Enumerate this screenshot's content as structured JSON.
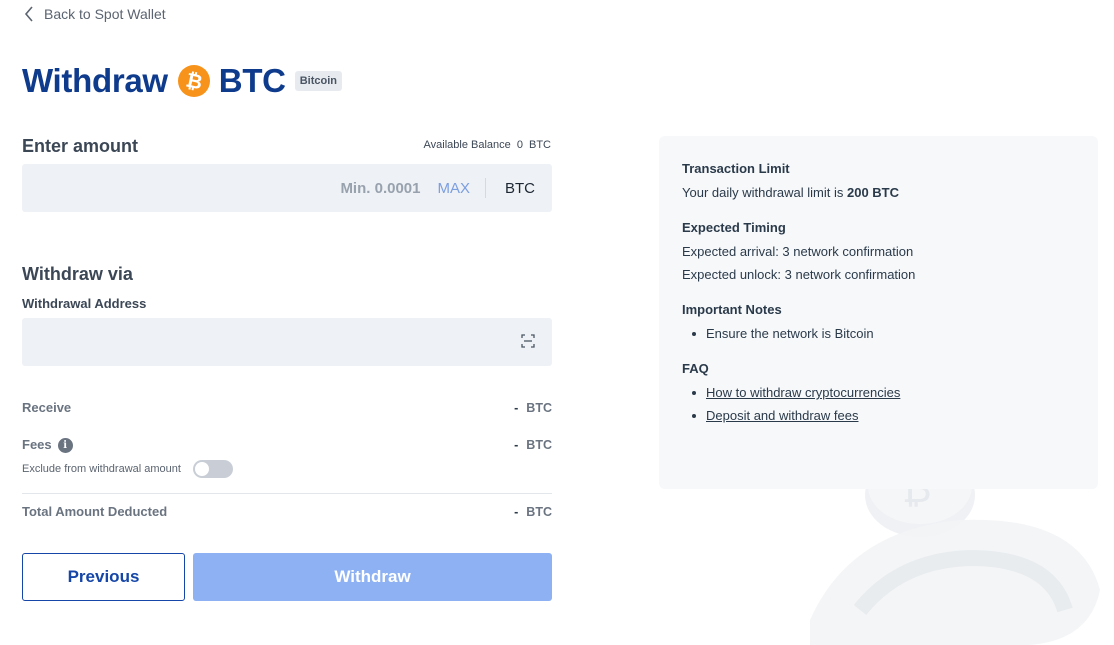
{
  "nav": {
    "back_label": "Back to Spot Wallet"
  },
  "header": {
    "title_prefix": "Withdraw",
    "coin_glyph": "₿",
    "coin_symbol": "BTC",
    "chain_badge": "Bitcoin",
    "coin_color": "#f7931a"
  },
  "amount": {
    "section_title": "Enter amount",
    "balance_label": "Available Balance",
    "balance_value": "0",
    "balance_unit": "BTC",
    "placeholder": "Min. 0.0001",
    "max_label": "MAX",
    "unit": "BTC"
  },
  "withdraw_via": {
    "section_title": "Withdraw via",
    "address_label": "Withdrawal Address",
    "address_value": ""
  },
  "summary": {
    "receive_label": "Receive",
    "receive_value": "-",
    "receive_unit": "BTC",
    "fees_label": "Fees",
    "fees_value": "-",
    "fees_unit": "BTC",
    "exclude_label": "Exclude from withdrawal amount",
    "exclude_toggle_on": false,
    "total_label": "Total Amount Deducted",
    "total_value": "-",
    "total_unit": "BTC"
  },
  "actions": {
    "previous_label": "Previous",
    "withdraw_label": "Withdraw",
    "primary_color": "#1546a8",
    "disabled_color": "#8db1f2"
  },
  "info": {
    "limit_title": "Transaction Limit",
    "limit_text": "Your daily withdrawal limit is",
    "limit_value": "200 BTC",
    "timing_title": "Expected Timing",
    "arrival_text": "Expected arrival: 3 network confirmation",
    "unlock_text": "Expected unlock: 3 network confirmation",
    "notes_title": "Important Notes",
    "notes": [
      "Ensure the network is Bitcoin"
    ],
    "faq_title": "FAQ",
    "faq_links": [
      "How to withdraw cryptocurrencies",
      "Deposit and withdraw fees"
    ]
  }
}
